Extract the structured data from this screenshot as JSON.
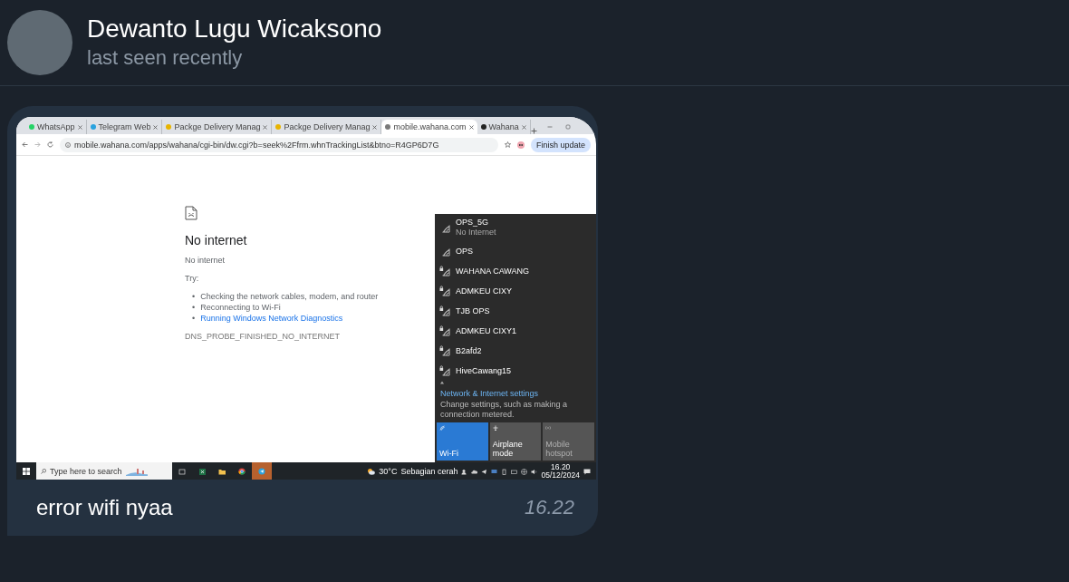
{
  "header": {
    "name": "Dewanto Lugu Wicaksono",
    "status": "last seen recently"
  },
  "message": {
    "caption": "error wifi nyaa",
    "time": "16.22",
    "screenshot": {
      "browser": {
        "tabs": [
          {
            "label": "WhatsApp",
            "selected": false,
            "color": "#25d366"
          },
          {
            "label": "Telegram Web",
            "selected": false,
            "color": "#2aa3df"
          },
          {
            "label": "Packge Delivery Manag",
            "selected": false,
            "color": "#e8b400"
          },
          {
            "label": "Packge Delivery Manag",
            "selected": false,
            "color": "#e8b400"
          },
          {
            "label": "mobile.wahana.com",
            "selected": true,
            "color": "#7a7a7a"
          },
          {
            "label": "Wahana",
            "selected": false,
            "color": "#222222"
          }
        ],
        "url": "mobile.wahana.com/apps/wahana/cgi-bin/dw.cgi?b=seek%2Ffrm.whnTrackingList&btno=R4GP6D7G",
        "update_button": "Finish update"
      },
      "error": {
        "title": "No internet",
        "subtitle": "No internet",
        "try_label": "Try:",
        "suggestions": [
          {
            "marker": "•",
            "text": "Checking the network cables, modem, and router",
            "kind": "text"
          },
          {
            "marker": "•",
            "text": "Reconnecting to Wi-Fi",
            "kind": "text"
          },
          {
            "marker": "•",
            "text": "Running Windows Network Diagnostics",
            "kind": "link"
          }
        ],
        "code": "DNS_PROBE_FINISHED_NO_INTERNET"
      },
      "wifi_panel": {
        "networks": [
          {
            "name": "OPS_5G",
            "status": "No Internet",
            "secured": false
          },
          {
            "name": "OPS",
            "secured": false
          },
          {
            "name": "WAHANA CAWANG",
            "secured": true
          },
          {
            "name": "ADMKEU CIXY",
            "secured": true
          },
          {
            "name": "TJB OPS",
            "secured": true
          },
          {
            "name": "ADMKEU CIXY1",
            "secured": true
          },
          {
            "name": "B2afd2",
            "secured": true
          },
          {
            "name": "HiveCawang15",
            "secured": true
          }
        ],
        "settings_link": "Network & Internet settings",
        "settings_hint": "Change settings, such as making a connection metered.",
        "quick_actions": [
          {
            "label": "Wi-Fi",
            "on": true,
            "disabled": false
          },
          {
            "label": "Airplane mode",
            "on": false,
            "disabled": false
          },
          {
            "label": "Mobile hotspot",
            "on": false,
            "disabled": true
          }
        ]
      },
      "taskbar": {
        "search_placeholder": "Type here to search",
        "temperature": "30°C",
        "weather": "Sebagian cerah",
        "time": "16.20",
        "date": "05/12/2024"
      }
    }
  }
}
